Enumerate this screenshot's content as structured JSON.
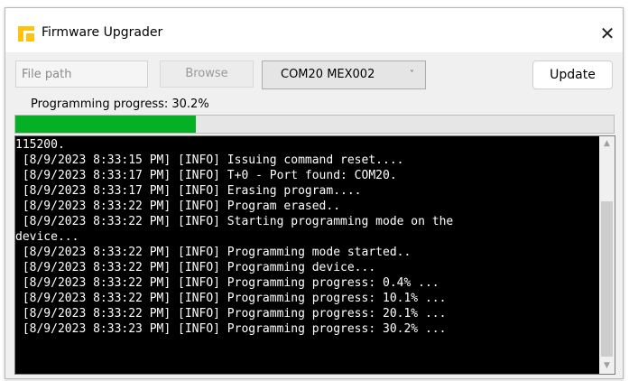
{
  "window": {
    "title": "Firmware Upgrader",
    "close_glyph": "✕"
  },
  "toolbar": {
    "file_path_placeholder": "File path",
    "browse_label": "Browse",
    "com_port_selected": "COM20 MEX002",
    "chevron_glyph": "˅",
    "update_label": "Update"
  },
  "progress": {
    "label": "Programming progress: 30.2%",
    "percent": 30.2,
    "fill_color": "#06b025"
  },
  "console": {
    "lines": [
      "115200.",
      " [8/9/2023 8:33:15 PM] [INFO] Issuing command reset....",
      " [8/9/2023 8:33:17 PM] [INFO] T+0 - Port found: COM20.",
      " [8/9/2023 8:33:17 PM] [INFO] Erasing program....",
      " [8/9/2023 8:33:22 PM] [INFO] Program erased..",
      " [8/9/2023 8:33:22 PM] [INFO] Starting programming mode on the",
      "device...",
      " [8/9/2023 8:33:22 PM] [INFO] Programming mode started..",
      " [8/9/2023 8:33:22 PM] [INFO] Programming device...",
      " [8/9/2023 8:33:22 PM] [INFO] Programming progress: 0.4% ...",
      " [8/9/2023 8:33:22 PM] [INFO] Programming progress: 10.1% ...",
      " [8/9/2023 8:33:22 PM] [INFO] Programming progress: 20.1% ...",
      " [8/9/2023 8:33:23 PM] [INFO] Programming progress: 30.2% ..."
    ]
  },
  "colors": {
    "accent_icon": "#ffc20e",
    "console_bg": "#000000",
    "console_text": "#ffffff"
  }
}
